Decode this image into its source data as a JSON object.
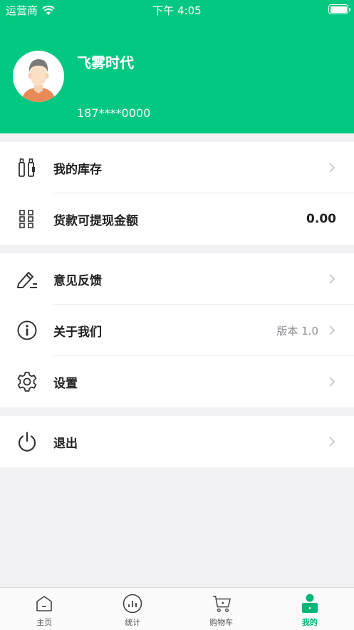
{
  "status_bar": {
    "carrier": "运营商",
    "time": "下午 4:05"
  },
  "profile": {
    "name": "飞雾时代",
    "phone": "187****0000"
  },
  "menu": {
    "inventory": {
      "label": "我的库存"
    },
    "withdrawable": {
      "label": "货款可提现金额",
      "value": "0.00"
    },
    "feedback": {
      "label": "意见反馈"
    },
    "about": {
      "label": "关于我们",
      "version": "版本 1.0"
    },
    "settings": {
      "label": "设置"
    },
    "logout": {
      "label": "退出"
    }
  },
  "tabbar": {
    "home": "主页",
    "stats": "统计",
    "cart": "购物车",
    "mine": "我的"
  },
  "colors": {
    "accent": "#00c880",
    "active_tab": "#00b67a"
  }
}
